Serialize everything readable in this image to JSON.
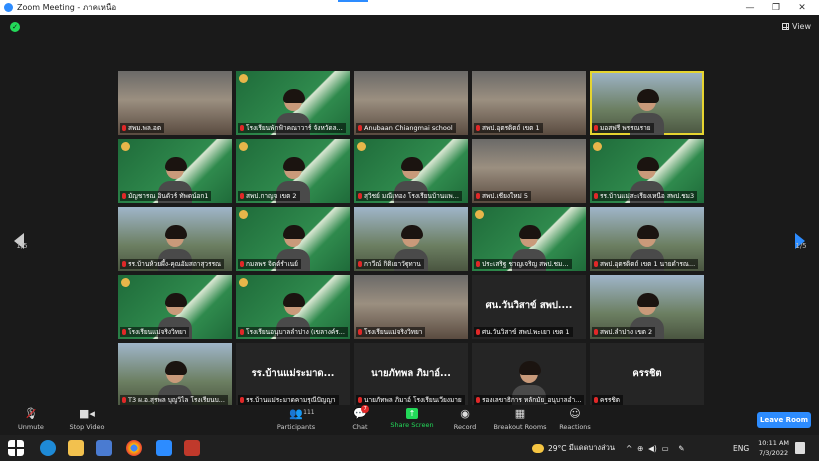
{
  "window": {
    "title": "Zoom Meeting - ภาคเหนือ",
    "minimize": "—",
    "restore": "❐",
    "close": "✕"
  },
  "meeting": {
    "view_label": "View",
    "page_left": "1/5",
    "page_right": "1/5",
    "tiles": [
      {
        "name": "สพม.พล.อต",
        "style": "room",
        "video": true,
        "active": false
      },
      {
        "name": "โรงเรียนพักฟ้าคณาวาร์ จังหวัดล...",
        "style": "green",
        "video": true,
        "active": false
      },
      {
        "name": "Anubaan Chiangmai school",
        "style": "room",
        "video": true,
        "active": false
      },
      {
        "name": "สพป.อุตรดิตถ์ เขต 1",
        "style": "room",
        "video": true,
        "active": false
      },
      {
        "name": "มอสฟรี พรรณราย",
        "style": "outdoor",
        "video": true,
        "active": true
      },
      {
        "name": "มัญชารณ อินดัวร์ ทัพดน์อก1",
        "style": "green",
        "video": true,
        "active": false
      },
      {
        "name": "สพป.กาญจ เขต 2",
        "style": "green",
        "video": true,
        "active": false
      },
      {
        "name": "สุวิชย์ มณีเทอง โรงเรียนบ้านแพ...",
        "style": "green",
        "video": true,
        "active": false
      },
      {
        "name": "สพป.เชียงใหม่ 5",
        "style": "room",
        "video": true,
        "active": false
      },
      {
        "name": "รร.บ้านแม่สะเรียงเหนือ สพป.ชม3",
        "style": "green",
        "video": true,
        "active": false
      },
      {
        "name": "รร.บ้านห้วยผึ้ง-คุณอัมสถาสุวรรณ",
        "style": "outdoor",
        "video": true,
        "active": false
      },
      {
        "name": "กมลพร จิตต์รำเนย์",
        "style": "green",
        "video": true,
        "active": false
      },
      {
        "name": "กาวีณ์ กิติเยาวัฐุทาน",
        "style": "outdoor",
        "video": true,
        "active": false
      },
      {
        "name": "ประเสริฐ ชาญเจริญ สพป.ชม...",
        "style": "green",
        "video": true,
        "active": false
      },
      {
        "name": "สพป.อุตรดิตถ์ เขต 1 นายดำรณ...",
        "style": "outdoor",
        "video": true,
        "active": false
      },
      {
        "name": "โรงเรียนแม่จริงวิทยา",
        "style": "green",
        "video": true,
        "active": false
      },
      {
        "name": "โรงเรียนอนุบาลลำปาง (เขลางค์ร...",
        "style": "green",
        "video": true,
        "active": false
      },
      {
        "name": "โรงเรียนแม่จริงวิทยา",
        "style": "room",
        "video": true,
        "active": false
      },
      {
        "name": "ศน.วันวิสาข์ สพป.พะเยา เขต 1",
        "style": "dark",
        "video": false,
        "big": "ศน.วันวิสาข์ สพป....",
        "active": false
      },
      {
        "name": "สพป.ลำปาง เขต 2",
        "style": "outdoor",
        "video": true,
        "active": false
      },
      {
        "name": "T3 ผ.อ.สุรพล บุญวิไล โรงเรียนบ...",
        "style": "outdoor",
        "video": true,
        "active": false
      },
      {
        "name": "รร.บ้านแม่ระมาดคามรุณีปัญญา",
        "style": "dark",
        "video": false,
        "big": "รร.บ้านแม่ระมาด...",
        "active": false
      },
      {
        "name": "นายภัทพล ภิมาอ์ โรงเรียนเวียงมาย",
        "style": "dark",
        "video": false,
        "big": "นายภัทพล ภิมาอ์...",
        "active": false
      },
      {
        "name": "รองเลขาธิการ หลักมัย_อนุบาลอำ...",
        "style": "dark",
        "video": true,
        "active": false
      },
      {
        "name": "ครรชิต",
        "style": "dark",
        "video": false,
        "big": "ครรชิต",
        "active": false
      }
    ]
  },
  "toolbar": {
    "unmute": "Unmute",
    "stop_video": "Stop Video",
    "participants": "Participants",
    "participants_count": "111",
    "chat": "Chat",
    "chat_badge": "7",
    "share_screen": "Share Screen",
    "record": "Record",
    "breakout": "Breakout Rooms",
    "reactions": "Reactions",
    "leave": "Leave Room"
  },
  "taskbar": {
    "weather": "29°C",
    "weather_desc": "มีแดดบางส่วน",
    "lang": "ENG",
    "time": "10:11 AM",
    "date": "7/3/2022"
  }
}
